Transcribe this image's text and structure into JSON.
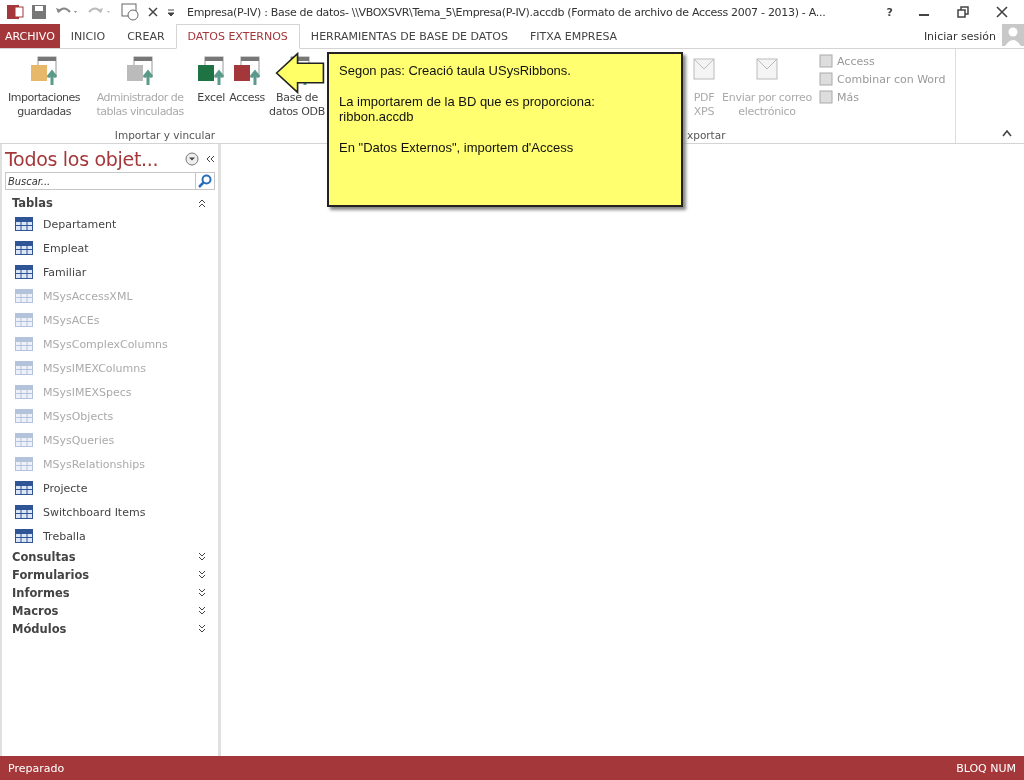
{
  "window": {
    "title": "Empresa(P-IV) : Base de datos- \\\\VBOXSVR\\Tema_5\\Empresa(P-IV).accdb (Formato de archivo de Access 2007 - 2013) - A...",
    "help": "?"
  },
  "tabs": [
    {
      "label": "ARCHIVO",
      "kind": "file",
      "selected": false
    },
    {
      "label": "INICIO",
      "kind": "tab",
      "selected": false
    },
    {
      "label": "CREAR",
      "kind": "tab",
      "selected": false
    },
    {
      "label": "DATOS EXTERNOS",
      "kind": "tab",
      "selected": true
    },
    {
      "label": "HERRAMIENTAS DE BASE DE DATOS",
      "kind": "tab",
      "selected": false
    },
    {
      "label": "FITXA EMPRESA",
      "kind": "tab",
      "selected": false
    }
  ],
  "account": {
    "label": "Iniciar sesión"
  },
  "ribbon": {
    "import_group": {
      "label": "Importar y vincular",
      "buttons": [
        {
          "label": "Importaciones guardadas",
          "disabled": false
        },
        {
          "label": "Administrador de tablas vinculadas",
          "disabled": true
        },
        {
          "label": "Excel",
          "disabled": false
        },
        {
          "label": "Access",
          "disabled": false
        },
        {
          "label": "Base de datos ODB",
          "disabled": false
        }
      ]
    },
    "export_group": {
      "label": "xportar",
      "buttons": [
        {
          "label": "PDF XPS",
          "disabled": true
        },
        {
          "label": "Enviar por correo electrónico",
          "disabled": true
        }
      ],
      "small_buttons": [
        {
          "label": "Access",
          "disabled": true
        },
        {
          "label": "Combinar con Word",
          "disabled": true
        },
        {
          "label": "Más",
          "disabled": true
        }
      ]
    }
  },
  "callout": {
    "paragraphs": [
      "Segon pas: Creació taula USysRibbons.",
      "La importarem de la BD que es proporciona: ribbon.accdb",
      "En \"Datos Externos\", importem d'Access"
    ]
  },
  "nav": {
    "title": "Todos los objet...",
    "search": {
      "placeholder": "Buscar..."
    },
    "groups": [
      {
        "label": "Tablas",
        "expanded": true,
        "items": [
          {
            "label": "Departament",
            "system": false
          },
          {
            "label": "Empleat",
            "system": false
          },
          {
            "label": "Familiar",
            "system": false
          },
          {
            "label": "MSysAccessXML",
            "system": true
          },
          {
            "label": "MSysACEs",
            "system": true
          },
          {
            "label": "MSysComplexColumns",
            "system": true
          },
          {
            "label": "MSysIMEXColumns",
            "system": true
          },
          {
            "label": "MSysIMEXSpecs",
            "system": true
          },
          {
            "label": "MSysObjects",
            "system": true
          },
          {
            "label": "MSysQueries",
            "system": true
          },
          {
            "label": "MSysRelationships",
            "system": true
          },
          {
            "label": "Projecte",
            "system": false
          },
          {
            "label": "Switchboard Items",
            "system": false
          },
          {
            "label": "Treballa",
            "system": false
          }
        ]
      },
      {
        "label": "Consultas",
        "expanded": false
      },
      {
        "label": "Formularios",
        "expanded": false
      },
      {
        "label": "Informes",
        "expanded": false
      },
      {
        "label": "Macros",
        "expanded": false
      },
      {
        "label": "Módulos",
        "expanded": false
      }
    ]
  },
  "status_bar": {
    "left": "Preparado",
    "right": "BLOQ NUM"
  }
}
